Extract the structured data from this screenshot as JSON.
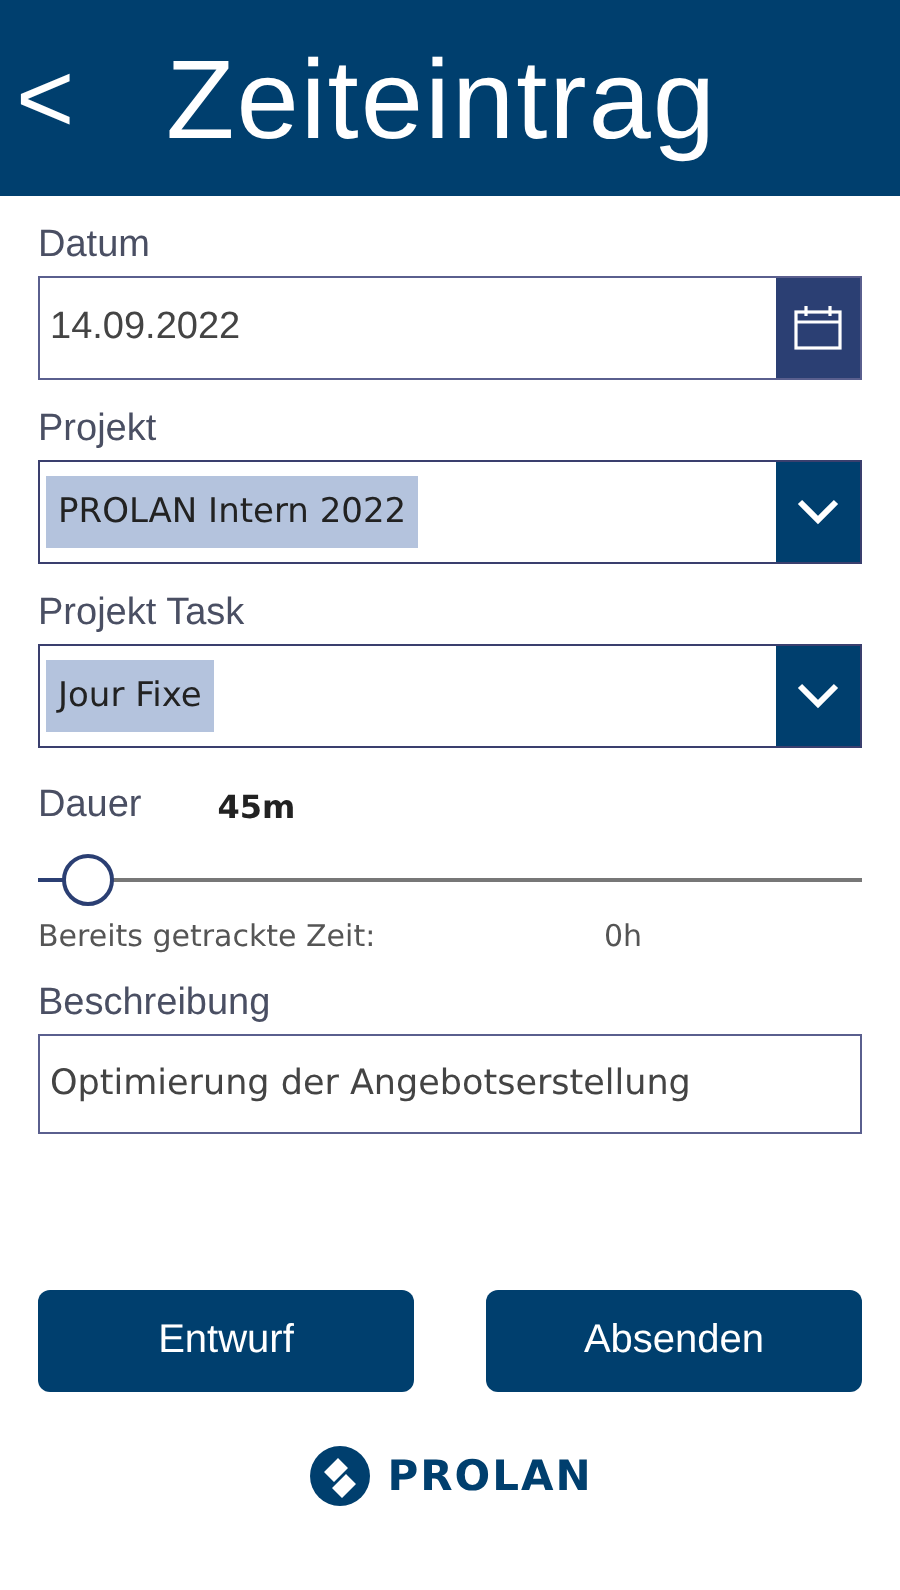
{
  "header": {
    "back": "<",
    "title": "Zeiteintrag"
  },
  "date": {
    "label": "Datum",
    "value": "14.09.2022"
  },
  "dropdowns": [
    {
      "label": "Projekt",
      "value": "PROLAN Intern 2022"
    },
    {
      "label": "Projekt Task",
      "value": "Jour Fixe"
    }
  ],
  "duration": {
    "label": "Dauer",
    "reading": "45m",
    "level": 0.06
  },
  "tracked": {
    "label": "Bereits getrackte Zeit:",
    "value": "0h"
  },
  "description": {
    "label": "Beschreibung",
    "value": "Optimierung der Angebotserstellung"
  },
  "buttons": [
    "Entwurf",
    "Absenden"
  ],
  "logo": {
    "text": "PROLAN"
  }
}
